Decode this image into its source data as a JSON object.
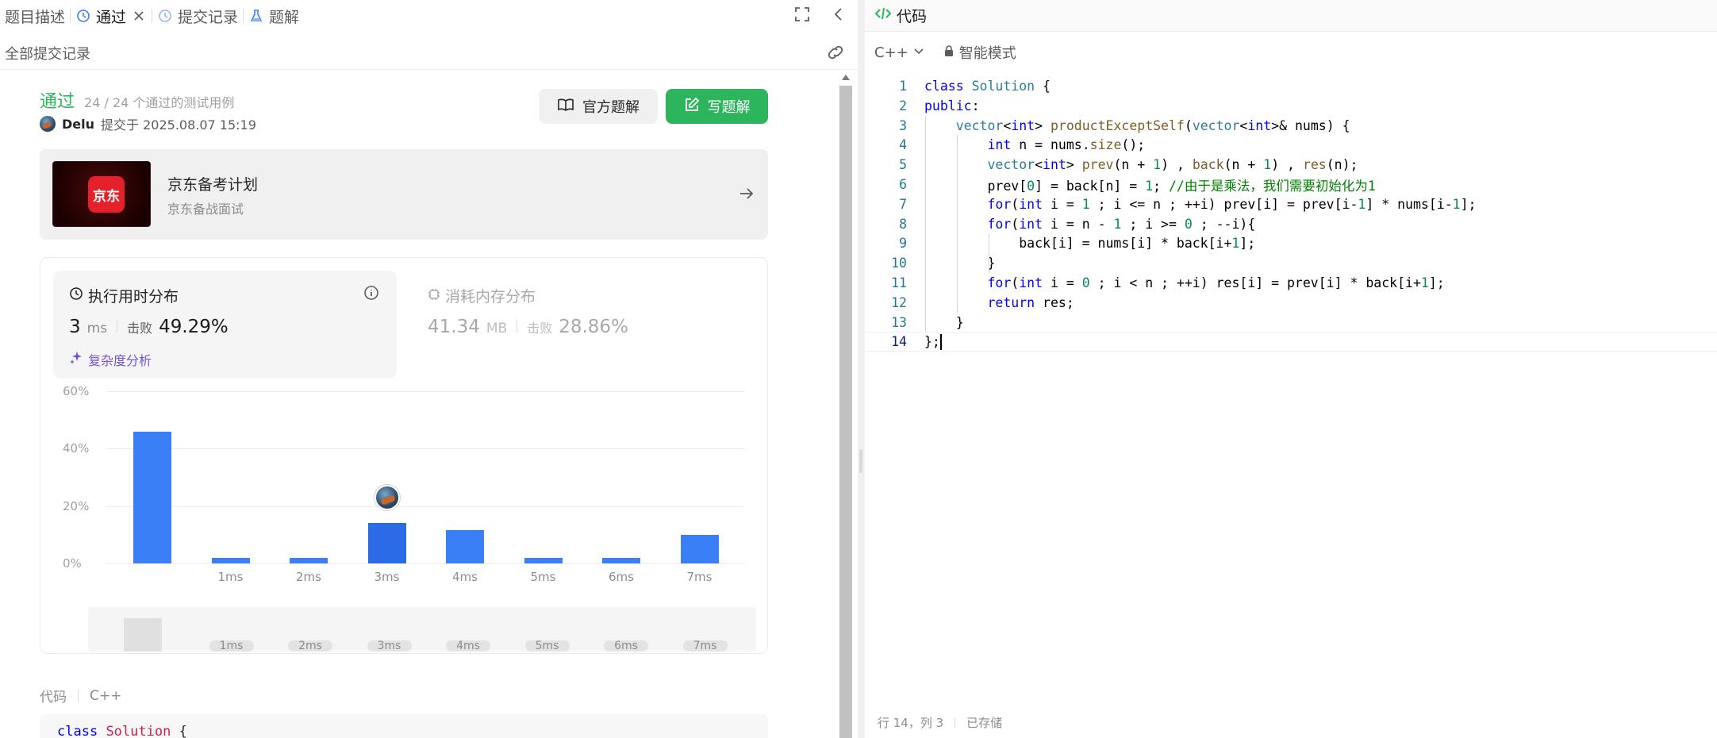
{
  "tabs": [
    {
      "label": "题目描述",
      "icon": "document-icon"
    },
    {
      "label": "通过",
      "icon": "history-icon",
      "active": true,
      "closable": true
    },
    {
      "label": "提交记录",
      "icon": "history-icon"
    },
    {
      "label": "题解",
      "icon": "flask-icon"
    }
  ],
  "subbar": {
    "title": "全部提交记录"
  },
  "submission": {
    "status": "通过",
    "cases": "24 / 24 个通过的测试用例",
    "author": "Delu",
    "submitted_at": "提交于 2025.08.07 15:19",
    "official_label": "官方题解",
    "write_label": "写题解"
  },
  "promo": {
    "title": "京东备考计划",
    "subtitle": "京东备战面试",
    "logo_text": "京东"
  },
  "runtime": {
    "title": "执行用时分布",
    "value": "3",
    "unit": "ms",
    "beat_label": "击败",
    "beat": "49.29%",
    "complexity": "复杂度分析"
  },
  "memory": {
    "title": "消耗内存分布",
    "value": "41.34",
    "unit": "MB",
    "beat_label": "击败",
    "beat": "28.86%"
  },
  "chart_data": {
    "type": "bar",
    "categories": [
      "",
      "1ms",
      "2ms",
      "3ms",
      "4ms",
      "5ms",
      "6ms",
      "7ms"
    ],
    "values": [
      46,
      2,
      2,
      14,
      11.5,
      2,
      2,
      10
    ],
    "y_ticks": [
      "60%",
      "40%",
      "20%",
      "0%"
    ],
    "ylim": [
      0,
      60
    ],
    "highlight_index": 3,
    "grid": true,
    "colors": {
      "bar": "#3a7ff6",
      "selected": "#2b6be8"
    }
  },
  "code_section": {
    "label": "代码",
    "lang": "C++",
    "preview_kw": "class",
    "preview_name": "Solution",
    "preview_rest": " {"
  },
  "right": {
    "title": "代码",
    "lang": "C++",
    "mode": "智能模式",
    "status_pos": "行 14，列 3",
    "status_saved": "已存储"
  },
  "code_lines": [
    "class Solution {",
    "public:",
    "    vector<int> productExceptSelf(vector<int>& nums) {",
    "        int n = nums.size();",
    "        vector<int> prev(n + 1) , back(n + 1) , res(n);",
    "        prev[0] = back[n] = 1; //由于是乘法，我们需要初始化为1",
    "        for(int i = 1 ; i <= n ; ++i) prev[i] = prev[i-1] * nums[i-1];",
    "        for(int i = n - 1 ; i >= 0 ; --i){",
    "            back[i] = nums[i] * back[i+1];",
    "        }",
    "        for(int i = 0 ; i < n ; ++i) res[i] = prev[i] * back[i+1];",
    "        return res;",
    "    }",
    "};"
  ],
  "colors": {
    "accent": "#2db55d",
    "bar": "#3a7ff6",
    "purple": "#7552d9"
  }
}
